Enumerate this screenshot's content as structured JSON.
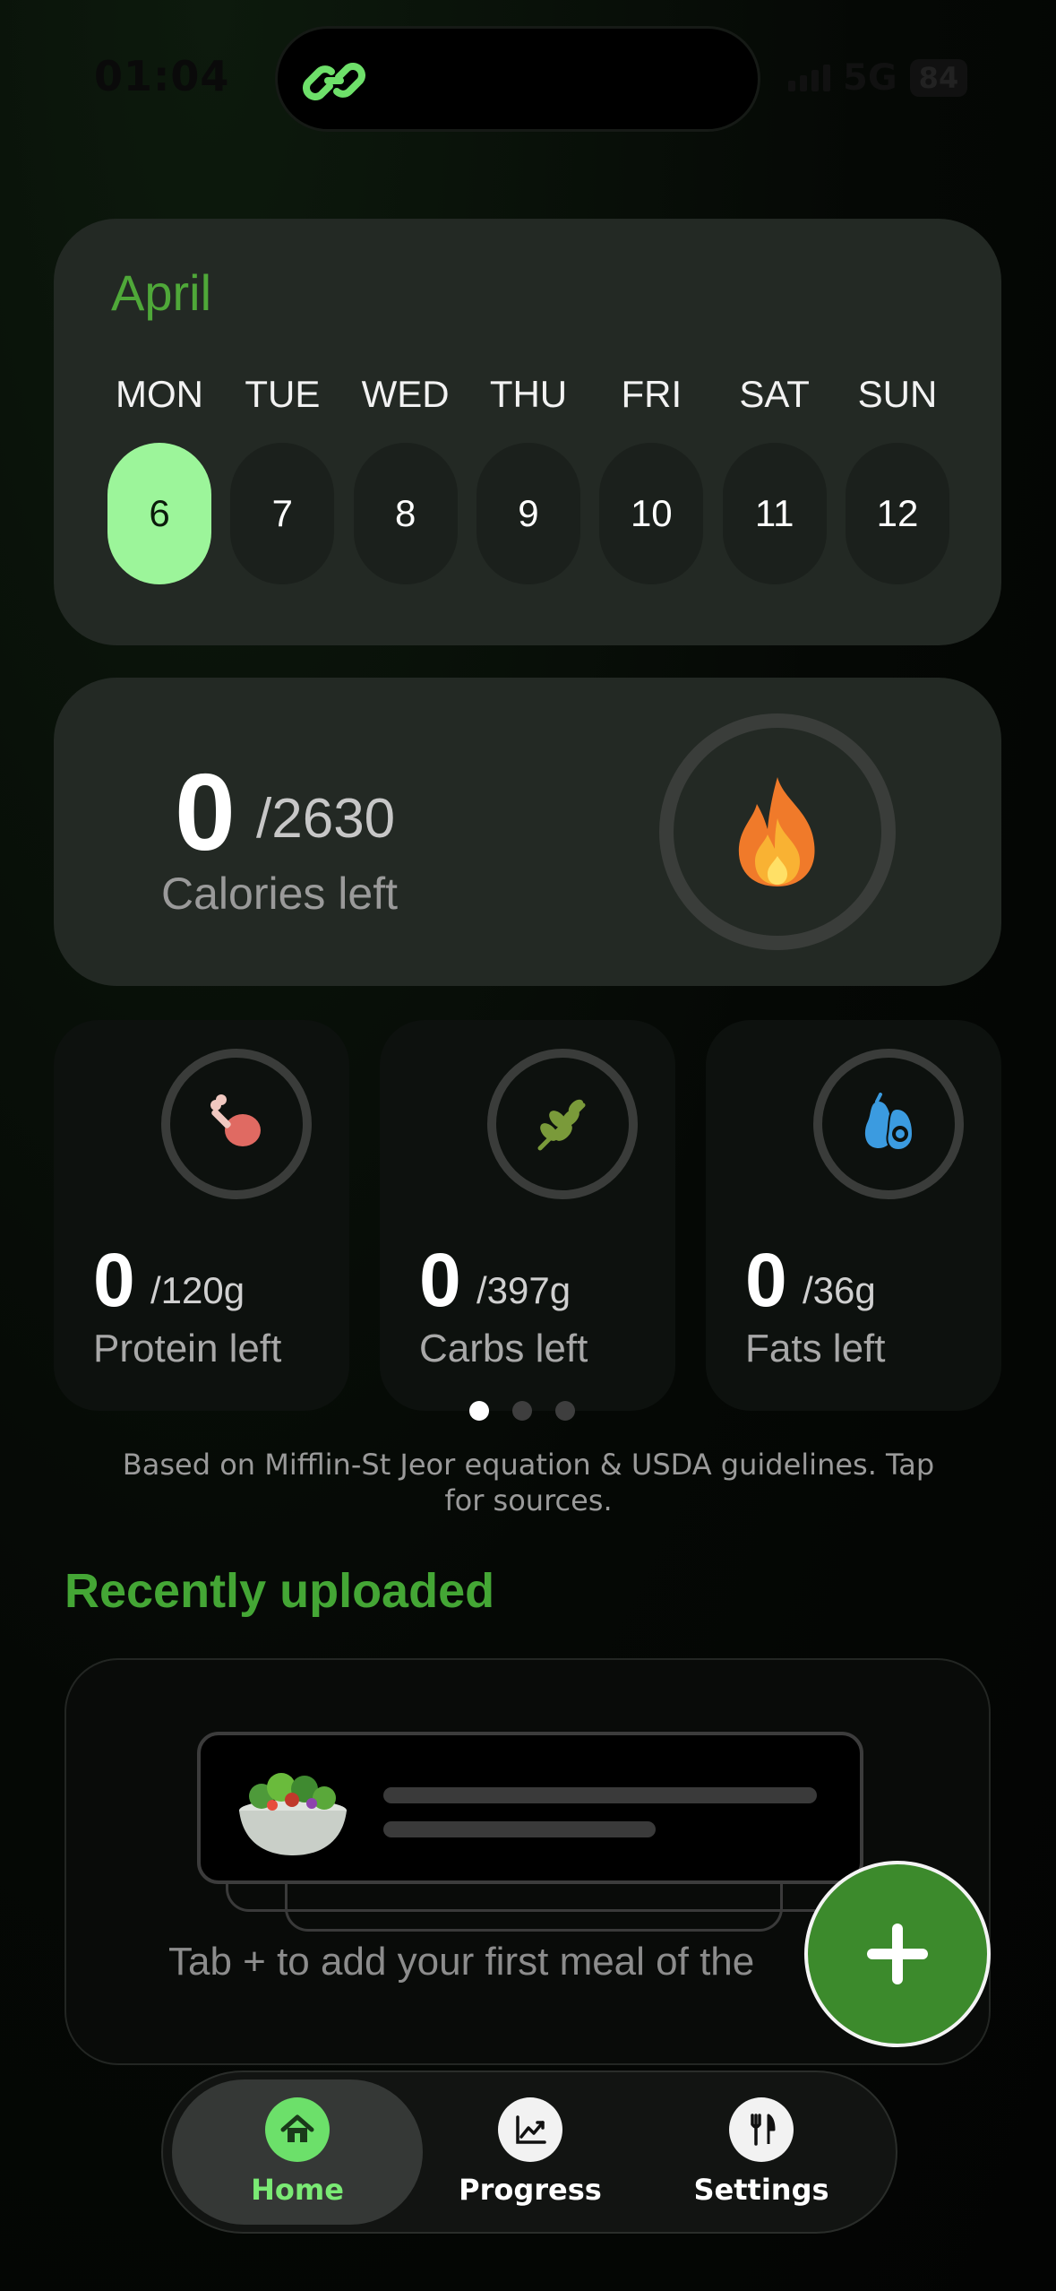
{
  "status_bar": {
    "time": "01:04",
    "network": "5G",
    "battery": "84"
  },
  "calendar": {
    "month": "April",
    "days": [
      {
        "name": "MON",
        "date": "6",
        "selected": true
      },
      {
        "name": "TUE",
        "date": "7"
      },
      {
        "name": "WED",
        "date": "8"
      },
      {
        "name": "THU",
        "date": "9"
      },
      {
        "name": "FRI",
        "date": "10"
      },
      {
        "name": "SAT",
        "date": "11"
      },
      {
        "name": "SUN",
        "date": "12"
      }
    ]
  },
  "calories": {
    "value": "0",
    "total": "/2630",
    "label": "Calories left",
    "icon": "flame-icon"
  },
  "macros": [
    {
      "value": "0",
      "total": "/120g",
      "label": "Protein left",
      "icon": "drumstick-icon",
      "color": "#e06a62"
    },
    {
      "value": "0",
      "total": "/397g",
      "label": "Carbs left",
      "icon": "wheat-icon",
      "color": "#7a9a3a"
    },
    {
      "value": "0",
      "total": "/36g",
      "label": "Fats left",
      "icon": "avocado-icon",
      "color": "#3b9be0"
    }
  ],
  "pager": {
    "count": 3,
    "active": 0
  },
  "sources_note": "Based on Mifflin-St Jeor equation & USDA guidelines. Tap for sources.",
  "recent": {
    "title": "Recently uploaded",
    "empty_text": "Tab + to add your first meal of the"
  },
  "fab": {
    "icon": "plus-icon"
  },
  "tabs": [
    {
      "label": "Home",
      "icon": "home-icon",
      "active": true
    },
    {
      "label": "Progress",
      "icon": "chart-icon"
    },
    {
      "label": "Settings",
      "icon": "fork-knife-icon"
    }
  ],
  "colors": {
    "accent": "#44a635",
    "selected_day": "#9cf59a",
    "fab": "#3c8a2c"
  }
}
